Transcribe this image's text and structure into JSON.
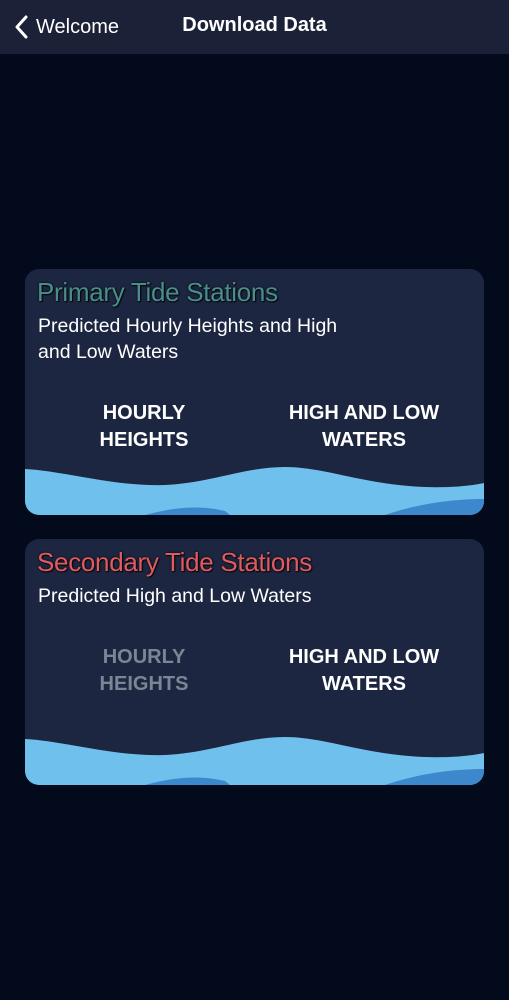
{
  "header": {
    "back_label": "Welcome",
    "title": "Download Data",
    "back_icon": "chevron-left-icon"
  },
  "cards": [
    {
      "title": "Primary Tide Stations",
      "subtitle": "Predicted Hourly Heights and High and Low Waters",
      "title_color": "#4a8e8c",
      "actions": [
        {
          "label": "HOURLY HEIGHTS",
          "enabled": true
        },
        {
          "label": "HIGH AND LOW WATERS",
          "enabled": true
        }
      ]
    },
    {
      "title": "Secondary Tide Stations",
      "subtitle": "Predicted High and Low Waters",
      "title_color": "#e05a5f",
      "actions": [
        {
          "label": "HOURLY HEIGHTS",
          "enabled": false
        },
        {
          "label": "HIGH AND LOW WATERS",
          "enabled": true
        }
      ]
    }
  ],
  "colors": {
    "background": "#030a1c",
    "navbar": "#1b2238",
    "card": "#1c2640",
    "wave_light": "#6fc0ec",
    "wave_dark": "#3d87cc"
  }
}
